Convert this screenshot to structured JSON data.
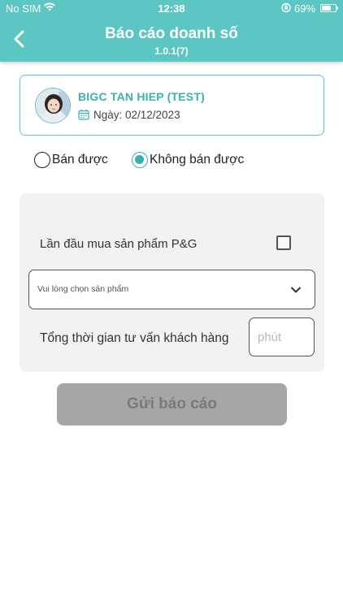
{
  "status_bar": {
    "carrier": "No SIM",
    "time": "12:38",
    "battery_percent": "69%",
    "battery_level": 0.69
  },
  "header": {
    "title": "Báo cáo doanh số",
    "version": "1.0.1(7)",
    "background": "#5cc6c3",
    "back_icon": "chevron-left-icon"
  },
  "store": {
    "name": "BIGC TAN HIEP (TEST)",
    "date_label": "Ngày: 02/12/2023",
    "accent": "#3ab1ae"
  },
  "sale_status": {
    "options": [
      {
        "label": "Bán được",
        "selected": false
      },
      {
        "label": "Không bán được",
        "selected": true
      }
    ]
  },
  "form": {
    "first_purchase_label": "Lần đầu mua sản phẩm P&G",
    "first_purchase_checked": false,
    "product_select_placeholder": "Vui lòng chọn sản phẩm",
    "consult_time_label": "Tổng thời gian tư vấn khách hàng",
    "minutes_placeholder": "phút"
  },
  "submit": {
    "label": "Gửi báo cáo",
    "enabled": false
  }
}
